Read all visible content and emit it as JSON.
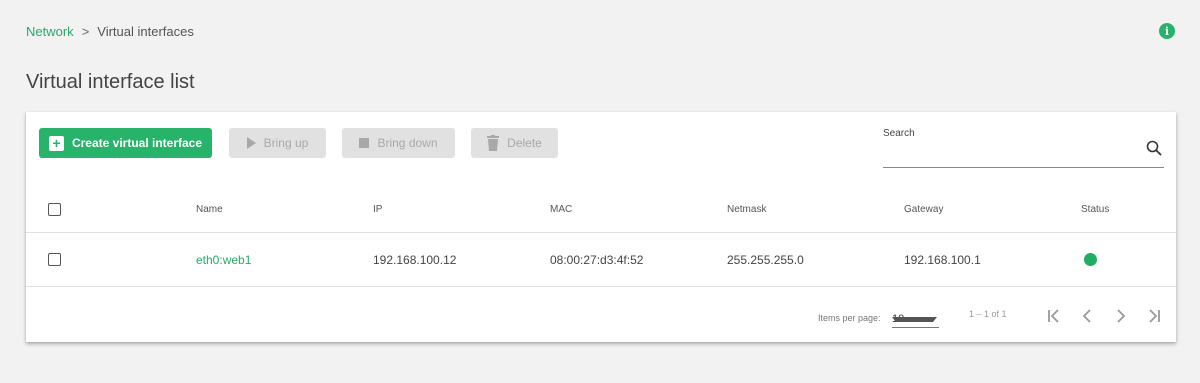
{
  "breadcrumb": {
    "parent": "Network",
    "separator": ">",
    "current": "Virtual interfaces"
  },
  "info_icon": {
    "glyph": "i",
    "icon": "info-icon"
  },
  "page": {
    "title": "Virtual interface list"
  },
  "toolbar": {
    "create_label": "Create virtual interface",
    "bring_up_label": "Bring up",
    "bring_down_label": "Bring down",
    "delete_label": "Delete"
  },
  "search": {
    "label": "Search",
    "value": ""
  },
  "table": {
    "headers": {
      "name": "Name",
      "ip": "IP",
      "mac": "MAC",
      "netmask": "Netmask",
      "gateway": "Gateway",
      "status": "Status"
    },
    "rows": [
      {
        "name": "eth0:web1",
        "ip": "192.168.100.12",
        "mac": "08:00:27:d3:4f:52",
        "netmask": "255.255.255.0",
        "gateway": "192.168.100.1",
        "status": "up"
      }
    ]
  },
  "paginator": {
    "items_per_page_label": "Items per page:",
    "items_per_page": "10",
    "range": "1 – 1 of 1"
  },
  "colors": {
    "accent": "#27b36a",
    "status_up": "#1fae62",
    "disabled_bg": "#e1e1e1",
    "disabled_text": "#a8a8a8"
  }
}
